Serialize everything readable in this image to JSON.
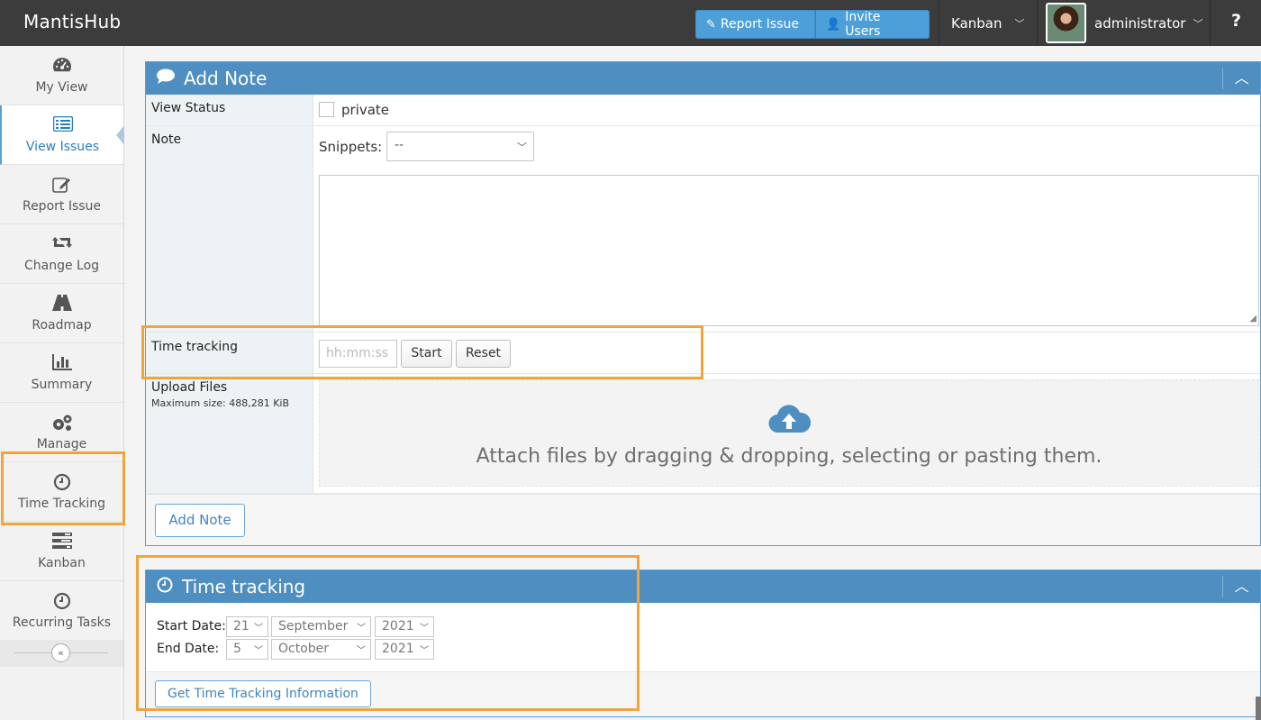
{
  "app": {
    "title": "MantisHub"
  },
  "navbar": {
    "report_issue": "Report Issue",
    "invite_users": "Invite Users",
    "kanban": "Kanban",
    "user": "administrator",
    "help": "?"
  },
  "sidebar": {
    "items": [
      {
        "label": "My View",
        "icon": "dashboard-icon"
      },
      {
        "label": "View Issues",
        "icon": "list-icon"
      },
      {
        "label": "Report Issue",
        "icon": "edit-icon"
      },
      {
        "label": "Change Log",
        "icon": "retweet-icon"
      },
      {
        "label": "Roadmap",
        "icon": "road-icon"
      },
      {
        "label": "Summary",
        "icon": "bar-chart-icon"
      },
      {
        "label": "Manage",
        "icon": "gears-icon"
      },
      {
        "label": "Time Tracking",
        "icon": "clock-icon"
      },
      {
        "label": "Kanban",
        "icon": "tasks-icon"
      },
      {
        "label": "Recurring Tasks",
        "icon": "clock-icon"
      }
    ],
    "active": "View Issues",
    "collapse": "«"
  },
  "add_note": {
    "title": "Add Note",
    "view_status_label": "View Status",
    "private_label": "private",
    "note_label": "Note",
    "snippets_label": "Snippets:",
    "snippets_value": "--",
    "time_tracking_label": "Time tracking",
    "time_placeholder": "hh:mm:ss",
    "start_label": "Start",
    "reset_label": "Reset",
    "upload_label": "Upload Files",
    "upload_max": "Maximum size: 488,281 KiB",
    "dropzone_text": "Attach files by dragging & dropping, selecting or pasting them.",
    "submit_label": "Add Note"
  },
  "time_tracking": {
    "title": "Time tracking",
    "start_date_label": "Start Date:",
    "start_day": "21",
    "start_month": "September",
    "start_year": "2021",
    "end_date_label": "End Date:",
    "end_day": "5",
    "end_month": "October",
    "end_year": "2021",
    "get_info_label": "Get Time Tracking Information"
  },
  "colors": {
    "navbar": "#3c3c3c",
    "accent": "#4e8ec0",
    "button_blue": "#4d9fd8",
    "highlight": "#f0a43a"
  }
}
